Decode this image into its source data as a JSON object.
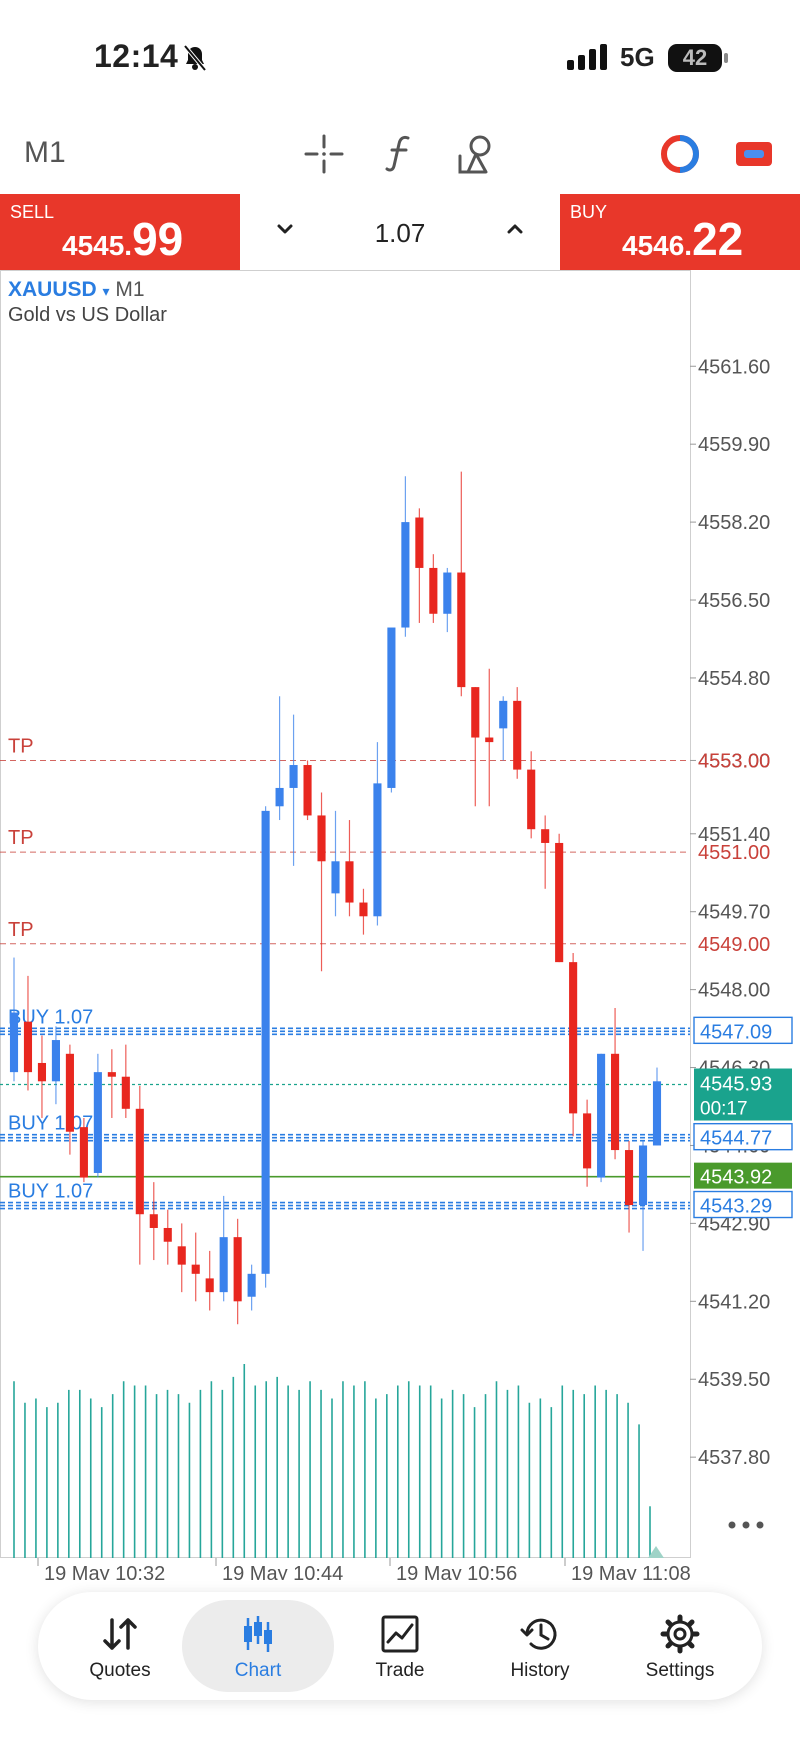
{
  "status": {
    "time": "12:14",
    "network": "5G",
    "battery": "42"
  },
  "toolbar": {
    "timeframe": "M1"
  },
  "trade": {
    "sell_label": "SELL",
    "sell_price_small": "4545.",
    "sell_price_big": "99",
    "buy_label": "BUY",
    "buy_price_small": "4546.",
    "buy_price_big": "22",
    "volume": "1.07"
  },
  "chart_header": {
    "symbol": "XAUUSD",
    "arrow": "▾",
    "timeframe": "M1",
    "description": "Gold vs US Dollar"
  },
  "chart_data": {
    "type": "candlestick",
    "symbol": "XAUUSD",
    "timeframe": "M1",
    "ylim": [
      4535.6,
      4563.7
    ],
    "y_ticks": [
      4561.6,
      4559.9,
      4558.2,
      4556.5,
      4554.8,
      4553.0,
      4551.4,
      4549.7,
      4548.0,
      4546.3,
      4544.6,
      4542.9,
      4541.2,
      4539.5,
      4537.8
    ],
    "x_ticks": [
      "19 May 10:32",
      "19 May 10:44",
      "19 May 10:56",
      "19 May 11:08"
    ],
    "candles": [
      {
        "o": 4546.2,
        "h": 4548.7,
        "l": 4546.0,
        "c": 4547.5
      },
      {
        "o": 4547.3,
        "h": 4548.3,
        "l": 4545.8,
        "c": 4546.2
      },
      {
        "o": 4546.4,
        "h": 4547.0,
        "l": 4545.2,
        "c": 4546.0
      },
      {
        "o": 4546.0,
        "h": 4547.2,
        "l": 4545.5,
        "c": 4546.9
      },
      {
        "o": 4546.6,
        "h": 4546.8,
        "l": 4544.4,
        "c": 4544.9
      },
      {
        "o": 4545.0,
        "h": 4545.2,
        "l": 4543.8,
        "c": 4543.9
      },
      {
        "o": 4544.0,
        "h": 4546.6,
        "l": 4543.9,
        "c": 4546.2
      },
      {
        "o": 4546.2,
        "h": 4546.7,
        "l": 4545.2,
        "c": 4546.1
      },
      {
        "o": 4546.1,
        "h": 4546.8,
        "l": 4545.2,
        "c": 4545.4
      },
      {
        "o": 4545.4,
        "h": 4545.9,
        "l": 4542.0,
        "c": 4543.1
      },
      {
        "o": 4543.1,
        "h": 4543.8,
        "l": 4542.1,
        "c": 4542.8
      },
      {
        "o": 4542.8,
        "h": 4543.2,
        "l": 4542.0,
        "c": 4542.5
      },
      {
        "o": 4542.4,
        "h": 4542.9,
        "l": 4541.4,
        "c": 4542.0
      },
      {
        "o": 4542.0,
        "h": 4542.7,
        "l": 4541.2,
        "c": 4541.8
      },
      {
        "o": 4541.7,
        "h": 4542.3,
        "l": 4541.0,
        "c": 4541.4
      },
      {
        "o": 4541.4,
        "h": 4543.5,
        "l": 4541.2,
        "c": 4542.6
      },
      {
        "o": 4542.6,
        "h": 4543.0,
        "l": 4540.7,
        "c": 4541.2
      },
      {
        "o": 4541.3,
        "h": 4542.0,
        "l": 4541.0,
        "c": 4541.8
      },
      {
        "o": 4541.8,
        "h": 4552.0,
        "l": 4541.5,
        "c": 4551.9
      },
      {
        "o": 4552.0,
        "h": 4554.4,
        "l": 4551.7,
        "c": 4552.4
      },
      {
        "o": 4552.4,
        "h": 4554.0,
        "l": 4550.7,
        "c": 4552.9
      },
      {
        "o": 4552.9,
        "h": 4553.0,
        "l": 4551.7,
        "c": 4551.8
      },
      {
        "o": 4551.8,
        "h": 4552.3,
        "l": 4548.4,
        "c": 4550.8
      },
      {
        "o": 4550.1,
        "h": 4551.9,
        "l": 4549.6,
        "c": 4550.8
      },
      {
        "o": 4550.8,
        "h": 4551.7,
        "l": 4549.6,
        "c": 4549.9
      },
      {
        "o": 4549.9,
        "h": 4550.2,
        "l": 4549.2,
        "c": 4549.6
      },
      {
        "o": 4549.6,
        "h": 4553.4,
        "l": 4549.4,
        "c": 4552.5
      },
      {
        "o": 4552.4,
        "h": 4555.3,
        "l": 4552.3,
        "c": 4555.9
      },
      {
        "o": 4555.9,
        "h": 4559.2,
        "l": 4555.7,
        "c": 4558.2
      },
      {
        "o": 4558.3,
        "h": 4558.5,
        "l": 4556.0,
        "c": 4557.2
      },
      {
        "o": 4557.2,
        "h": 4557.5,
        "l": 4556.0,
        "c": 4556.2
      },
      {
        "o": 4556.2,
        "h": 4557.2,
        "l": 4555.8,
        "c": 4557.1
      },
      {
        "o": 4557.1,
        "h": 4559.3,
        "l": 4554.4,
        "c": 4554.6
      },
      {
        "o": 4554.6,
        "h": 4554.6,
        "l": 4552.0,
        "c": 4553.5
      },
      {
        "o": 4553.5,
        "h": 4555.0,
        "l": 4552.0,
        "c": 4553.4
      },
      {
        "o": 4553.7,
        "h": 4554.4,
        "l": 4553.0,
        "c": 4554.3
      },
      {
        "o": 4554.3,
        "h": 4554.6,
        "l": 4552.6,
        "c": 4552.8
      },
      {
        "o": 4552.8,
        "h": 4553.2,
        "l": 4551.3,
        "c": 4551.5
      },
      {
        "o": 4551.5,
        "h": 4551.8,
        "l": 4550.2,
        "c": 4551.2
      },
      {
        "o": 4551.2,
        "h": 4551.4,
        "l": 4548.6,
        "c": 4548.6
      },
      {
        "o": 4548.6,
        "h": 4548.8,
        "l": 4544.8,
        "c": 4545.3
      },
      {
        "o": 4545.3,
        "h": 4545.6,
        "l": 4543.7,
        "c": 4544.1
      },
      {
        "o": 4543.9,
        "h": 4546.6,
        "l": 4543.8,
        "c": 4546.6
      },
      {
        "o": 4546.6,
        "h": 4547.6,
        "l": 4544.3,
        "c": 4544.5
      },
      {
        "o": 4544.5,
        "h": 4544.7,
        "l": 4542.7,
        "c": 4543.3
      },
      {
        "o": 4543.3,
        "h": 4544.7,
        "l": 4542.3,
        "c": 4544.6
      },
      {
        "o": 4544.6,
        "h": 4546.3,
        "l": 4544.6,
        "c": 4546.0
      }
    ],
    "volumes": [
      41,
      36,
      37,
      35,
      36,
      39,
      39,
      37,
      35,
      38,
      41,
      40,
      40,
      38,
      39,
      38,
      36,
      39,
      41,
      39,
      42,
      45,
      40,
      41,
      42,
      40,
      39,
      41,
      39,
      37,
      41,
      40,
      41,
      37,
      38,
      40,
      41,
      40,
      40,
      37,
      39,
      38,
      35,
      38,
      41,
      39,
      40,
      36,
      37,
      35,
      40,
      39,
      38,
      40,
      39,
      38,
      36,
      31,
      12
    ],
    "levels": [
      {
        "label": "TP",
        "price": 4553.0,
        "kind": "tp"
      },
      {
        "label": "TP",
        "price": 4551.0,
        "kind": "tp"
      },
      {
        "label": "TP",
        "price": 4549.0,
        "kind": "tp"
      },
      {
        "label": "BUY 1.07",
        "price": 4547.09,
        "kind": "buy"
      },
      {
        "label": "BUY 1.07",
        "price": 4544.77,
        "kind": "buy"
      },
      {
        "label": "BUY 1.07",
        "price": 4543.29,
        "kind": "buy"
      }
    ],
    "price_tags": [
      {
        "text": "4553.00",
        "kind": "tp",
        "price": 4553.0
      },
      {
        "text": "4551.00",
        "kind": "tp",
        "price": 4551.0
      },
      {
        "text": "4549.00",
        "kind": "tp",
        "price": 4549.0
      },
      {
        "text": "4547.09",
        "kind": "buy",
        "price": 4547.09
      },
      {
        "text": "4544.77",
        "kind": "buy",
        "price": 4544.77
      },
      {
        "text": "4543.92",
        "kind": "bid",
        "price": 4543.92
      },
      {
        "text": "4543.29",
        "kind": "buy",
        "price": 4543.29
      }
    ],
    "current": {
      "price_text": "4545.93",
      "countdown": "00:17",
      "price": 4545.93
    },
    "colors": {
      "bull": "#3b82ec",
      "bear": "#e8271f",
      "tp": "#c9413a",
      "buy": "#2a7de1",
      "bid": "#4a9a2c",
      "current": "#1aa38d",
      "volume": "#26a69a"
    }
  },
  "nav": {
    "items": [
      {
        "label": "Quotes"
      },
      {
        "label": "Chart"
      },
      {
        "label": "Trade"
      },
      {
        "label": "History"
      },
      {
        "label": "Settings"
      }
    ]
  }
}
